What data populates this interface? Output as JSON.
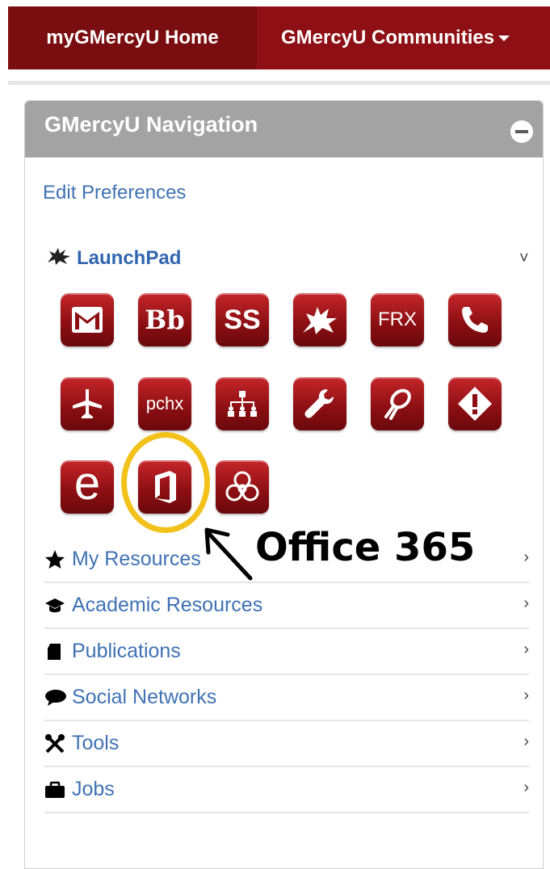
{
  "topnav": {
    "home_label": "myGMercyU Home",
    "communities_label": "GMercyU Communities",
    "accent": "#8e1014"
  },
  "panel": {
    "title": "GMercyU Navigation",
    "edit_preferences": "Edit Preferences",
    "launchpad_label": "LaunchPad"
  },
  "launchpad_icons": [
    {
      "name": "gmail-icon",
      "text": ""
    },
    {
      "name": "blackboard-icon",
      "text": "Bb"
    },
    {
      "name": "self-service-icon",
      "text": "SS"
    },
    {
      "name": "griffin-icon",
      "text": ""
    },
    {
      "name": "frx-icon",
      "text": "FRX"
    },
    {
      "name": "phone-icon",
      "text": ""
    },
    {
      "name": "airplane-icon",
      "text": ""
    },
    {
      "name": "pchx-icon",
      "text": "pchx"
    },
    {
      "name": "org-chart-icon",
      "text": ""
    },
    {
      "name": "wrench-icon",
      "text": ""
    },
    {
      "name": "ribbon-icon",
      "text": ""
    },
    {
      "name": "alert-icon",
      "text": ""
    },
    {
      "name": "e-icon",
      "text": "e"
    },
    {
      "name": "office365-icon",
      "text": ""
    },
    {
      "name": "biohazard-icon",
      "text": ""
    }
  ],
  "annotation": {
    "label": "Office 365",
    "ring_color": "#f2c21b"
  },
  "resources": [
    {
      "label": "My Resources",
      "icon": "star-icon"
    },
    {
      "label": "Academic Resources",
      "icon": "graduation-cap-icon"
    },
    {
      "label": "Publications",
      "icon": "book-icon"
    },
    {
      "label": "Social Networks",
      "icon": "speech-bubble-icon"
    },
    {
      "label": "Tools",
      "icon": "tools-icon"
    },
    {
      "label": "Jobs",
      "icon": "briefcase-icon"
    }
  ]
}
